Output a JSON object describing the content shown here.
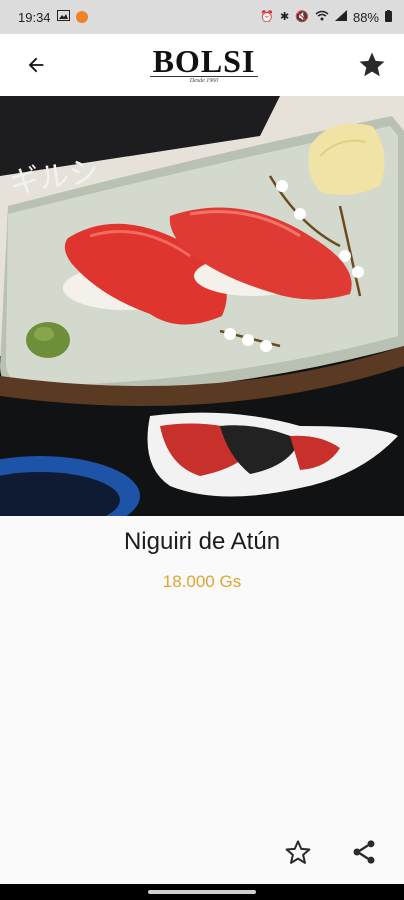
{
  "status_bar": {
    "time": "19:34",
    "battery": "88%",
    "left_icons": [
      "image-icon",
      "notification-dot-icon"
    ],
    "right_icons": [
      "alarm-icon",
      "bluetooth-icon",
      "mute-icon",
      "wifi-icon",
      "signal-icon",
      "battery-icon"
    ]
  },
  "app_bar": {
    "logo_text": "BOLSI",
    "logo_tagline": "Desde 1960",
    "back_icon": "arrow-left-icon",
    "favorite_icon": "star-filled-icon"
  },
  "product": {
    "name": "Niguiri de Atún",
    "price": "18.000 Gs",
    "price_color": "#e0a431"
  },
  "actions": {
    "favorite_icon": "star-outline-icon",
    "share_icon": "share-icon"
  }
}
